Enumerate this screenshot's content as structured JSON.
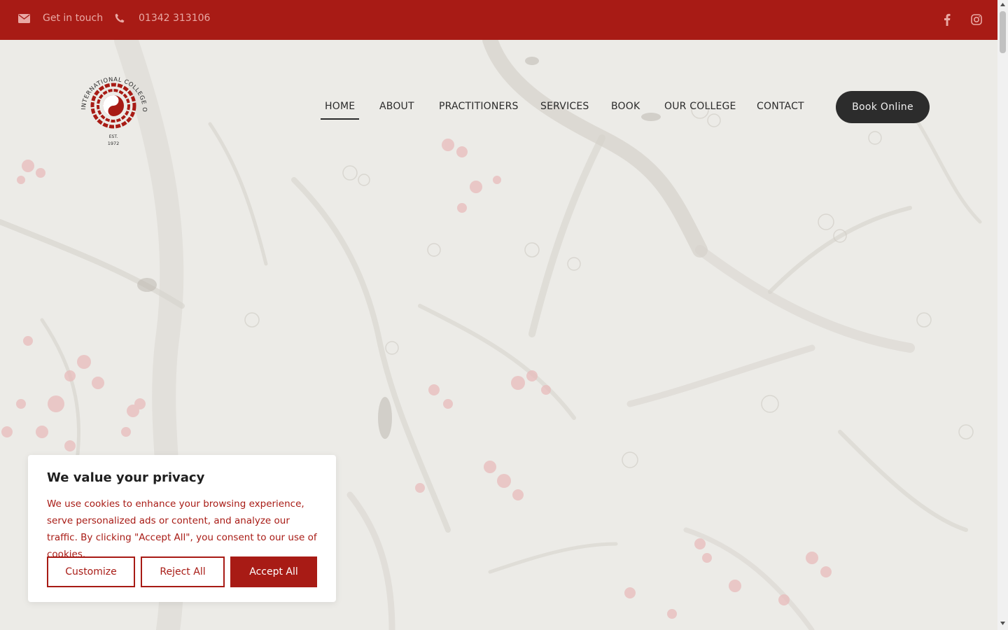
{
  "topbar": {
    "email_icon": "envelope-icon",
    "email_label": "Get in touch",
    "phone_icon": "phone-icon",
    "phone_label": "01342 313106",
    "social": [
      "facebook-icon",
      "instagram-icon"
    ],
    "color": "#a81b15"
  },
  "logo": {
    "ring_text": "INTERNATIONAL COLLEGE OF ORIENTAL MEDICINE",
    "est_label": "EST.",
    "year": "1972"
  },
  "nav": {
    "items": [
      {
        "label": "HOME",
        "active": true
      },
      {
        "label": "ABOUT"
      },
      {
        "label": "PRACTITIONERS"
      },
      {
        "label": "SERVICES"
      },
      {
        "label": "BOOK"
      },
      {
        "label": "OUR COLLEGE"
      },
      {
        "label": "CONTACT"
      }
    ],
    "cta": "Book Online"
  },
  "cookie": {
    "title": "We value your privacy",
    "text": "We use cookies to enhance your browsing experience, serve personalized ads or content, and analyze our traffic. By clicking \"Accept All\", you consent to our use of cookies.",
    "customize": "Customize",
    "reject": "Reject All",
    "accept": "Accept All"
  }
}
